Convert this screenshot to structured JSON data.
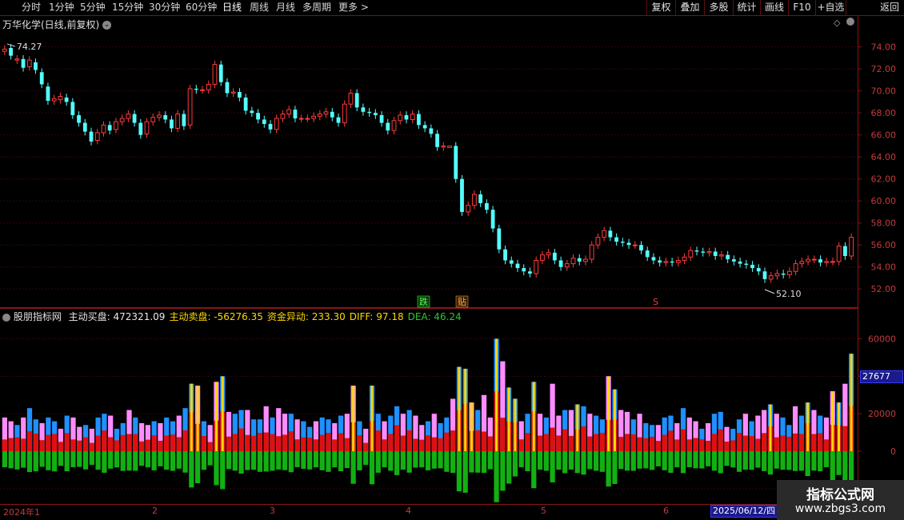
{
  "toolbar": {
    "periods": [
      "分时",
      "1分钟",
      "5分钟",
      "15分钟",
      "30分钟",
      "60分钟",
      "日线",
      "周线",
      "月线",
      "多周期",
      "更多 >"
    ],
    "buttons": [
      "复权",
      "叠加",
      "多股",
      "统计",
      "画线",
      "F10",
      "+自选",
      "返回"
    ]
  },
  "main_panel": {
    "stock_title": "万华化学(日线,前复权)",
    "high_label": "74.27",
    "low_label": "52.10",
    "markers": [
      "跌",
      "贴",
      "S"
    ]
  },
  "indicator_panel": {
    "name": "股朋指标网",
    "items": [
      {
        "label": "主动买盘:",
        "value": "472321.09",
        "color": "#e8e8e8"
      },
      {
        "label": "主动卖盘:",
        "value": "-56276.35",
        "color": "#ffd700"
      },
      {
        "label": "资金异动:",
        "value": "233.30",
        "color": "#ffd700"
      },
      {
        "label": "DIFF:",
        "value": "97.18",
        "color": "#ffd700"
      },
      {
        "label": "DEA:",
        "value": "46.24",
        "color": "#2ec52e"
      }
    ],
    "cursor_value": "27677"
  },
  "date_axis": {
    "labels": [
      "2024年1",
      "2",
      "3",
      "4",
      "5",
      "6"
    ],
    "cursor_date": "2025/06/12/四"
  },
  "watermark": {
    "line1": "指标公式网",
    "line2": "www.zbgs3.com"
  },
  "chart_data": [
    {
      "type": "candlestick",
      "ylim": [
        51,
        75.5
      ],
      "yticks": [
        "74.00",
        "72.00",
        "70.00",
        "68.00",
        "66.00",
        "64.00",
        "62.00",
        "60.00",
        "58.00",
        "56.00",
        "54.00",
        "52.00"
      ],
      "close": [
        73.8,
        73.2,
        72.9,
        72.1,
        72.8,
        71.9,
        70.6,
        69.1,
        69.3,
        69.5,
        69.0,
        67.8,
        67.1,
        66.3,
        65.4,
        66.2,
        66.9,
        66.4,
        67.2,
        67.5,
        67.9,
        67.1,
        66.0,
        67.2,
        67.6,
        67.8,
        67.4,
        66.6,
        67.9,
        66.8,
        70.2,
        70.1,
        70.1,
        70.6,
        72.4,
        70.8,
        69.8,
        69.9,
        69.4,
        68.2,
        68.0,
        67.4,
        67.0,
        66.5,
        67.5,
        67.9,
        68.3,
        67.5,
        67.5,
        67.5,
        67.7,
        67.9,
        68.1,
        67.6,
        67.1,
        68.8,
        69.8,
        68.5,
        68.1,
        68.0,
        67.8,
        67.1,
        66.4,
        67.3,
        67.8,
        67.4,
        67.9,
        66.9,
        66.6,
        66.1,
        64.9,
        65.0,
        null,
        62.0,
        59.0,
        59.6,
        60.6,
        59.8,
        59.2,
        57.5,
        55.6,
        54.6,
        54.3,
        53.9,
        53.6,
        53.4,
        54.6,
        55.1,
        55.3,
        54.6,
        54.0,
        54.3,
        54.8,
        54.5,
        54.7,
        56.0,
        56.7,
        57.3,
        56.7,
        56.3,
        56.2,
        56.0,
        56.0,
        55.5,
        54.9,
        54.6,
        54.4,
        54.5,
        54.4,
        54.6,
        54.9,
        55.5,
        55.4,
        55.3,
        55.4,
        55.0,
        55.1,
        54.7,
        54.5,
        54.3,
        54.2,
        53.9,
        53.6,
        52.9,
        53.2,
        53.4,
        53.3,
        53.6,
        54.3,
        54.5,
        54.7,
        54.7,
        54.4,
        54.5,
        54.5,
        55.9,
        55.0,
        56.7
      ],
      "open": [
        73.6,
        73.9,
        72.8,
        72.9,
        72.2,
        72.6,
        71.7,
        70.4,
        69.1,
        69.2,
        69.4,
        69.0,
        67.8,
        67.1,
        66.3,
        65.5,
        66.2,
        66.9,
        66.5,
        67.2,
        67.5,
        67.9,
        67.1,
        66.1,
        67.2,
        67.6,
        67.8,
        67.4,
        66.6,
        67.9,
        66.9,
        70.2,
        70.1,
        70.1,
        70.6,
        72.4,
        70.8,
        69.8,
        69.9,
        69.4,
        68.2,
        68.0,
        67.4,
        67.0,
        66.5,
        67.5,
        67.9,
        68.3,
        67.5,
        67.5,
        67.5,
        67.7,
        67.9,
        68.1,
        67.6,
        67.1,
        68.8,
        69.8,
        68.5,
        68.1,
        68.0,
        67.8,
        67.1,
        66.4,
        67.3,
        67.8,
        67.4,
        67.9,
        66.9,
        66.6,
        66.1,
        64.9,
        null,
        65.0,
        62.0,
        59.0,
        59.6,
        60.6,
        59.8,
        59.2,
        57.5,
        55.6,
        54.6,
        54.3,
        53.9,
        53.6,
        53.4,
        54.6,
        55.1,
        55.3,
        54.6,
        54.0,
        54.3,
        54.8,
        54.5,
        54.7,
        56.0,
        56.7,
        57.3,
        56.7,
        56.3,
        56.2,
        56.0,
        56.0,
        55.5,
        54.9,
        54.6,
        54.4,
        54.5,
        54.4,
        54.6,
        54.9,
        55.5,
        55.4,
        55.3,
        55.4,
        55.0,
        55.1,
        54.7,
        54.5,
        54.3,
        54.2,
        53.9,
        53.6,
        52.9,
        53.2,
        53.4,
        53.3,
        53.6,
        54.3,
        54.5,
        54.7,
        54.7,
        54.4,
        54.5,
        54.5,
        55.9,
        55.0
      ]
    },
    {
      "type": "bar",
      "ylim": [
        -26000,
        70000
      ],
      "yticks": [
        "60000",
        "40000",
        "20000",
        "0",
        "-20000"
      ],
      "series": [
        {
          "name": "主动买盘",
          "values": [
            18000,
            16000,
            14000,
            18000,
            23000,
            17000,
            15000,
            18000,
            16000,
            12000,
            19000,
            18000,
            13000,
            14000,
            12000,
            18000,
            20000,
            19000,
            12000,
            15000,
            22000,
            18000,
            15000,
            14000,
            16000,
            15000,
            18000,
            16000,
            19000,
            23000,
            36000,
            35000,
            16000,
            14000,
            37000,
            40000,
            21000,
            20000,
            22000,
            22000,
            17000,
            17000,
            24000,
            18000,
            23000,
            20000,
            20000,
            17000,
            16000,
            13000,
            16000,
            18000,
            17000,
            15000,
            19000,
            20000,
            35000,
            16000,
            12000,
            35000,
            20000,
            16000,
            19000,
            24000,
            20000,
            22000,
            19000,
            14000,
            16000,
            20000,
            15000,
            18000,
            28000,
            45000,
            44000,
            26000,
            22000,
            30000,
            18000,
            60000,
            48000,
            34000,
            28000,
            16000,
            20000,
            37000,
            20000,
            18000,
            36000,
            19000,
            22000,
            22000,
            25000,
            24000,
            20000,
            19000,
            17000,
            40000,
            33000,
            22000,
            21000,
            17000,
            20000,
            15000,
            14000,
            14000,
            18000,
            19000,
            15000,
            23000,
            18000,
            16000,
            12000,
            15000,
            20000,
            21000,
            13000,
            12000,
            17000,
            20000,
            16000,
            19000,
            22000,
            25000,
            20000,
            18000,
            14000,
            24000,
            19000,
            26000,
            22000,
            19000,
            18000,
            32000,
            26000,
            36000,
            52000
          ]
        }
      ]
    }
  ]
}
